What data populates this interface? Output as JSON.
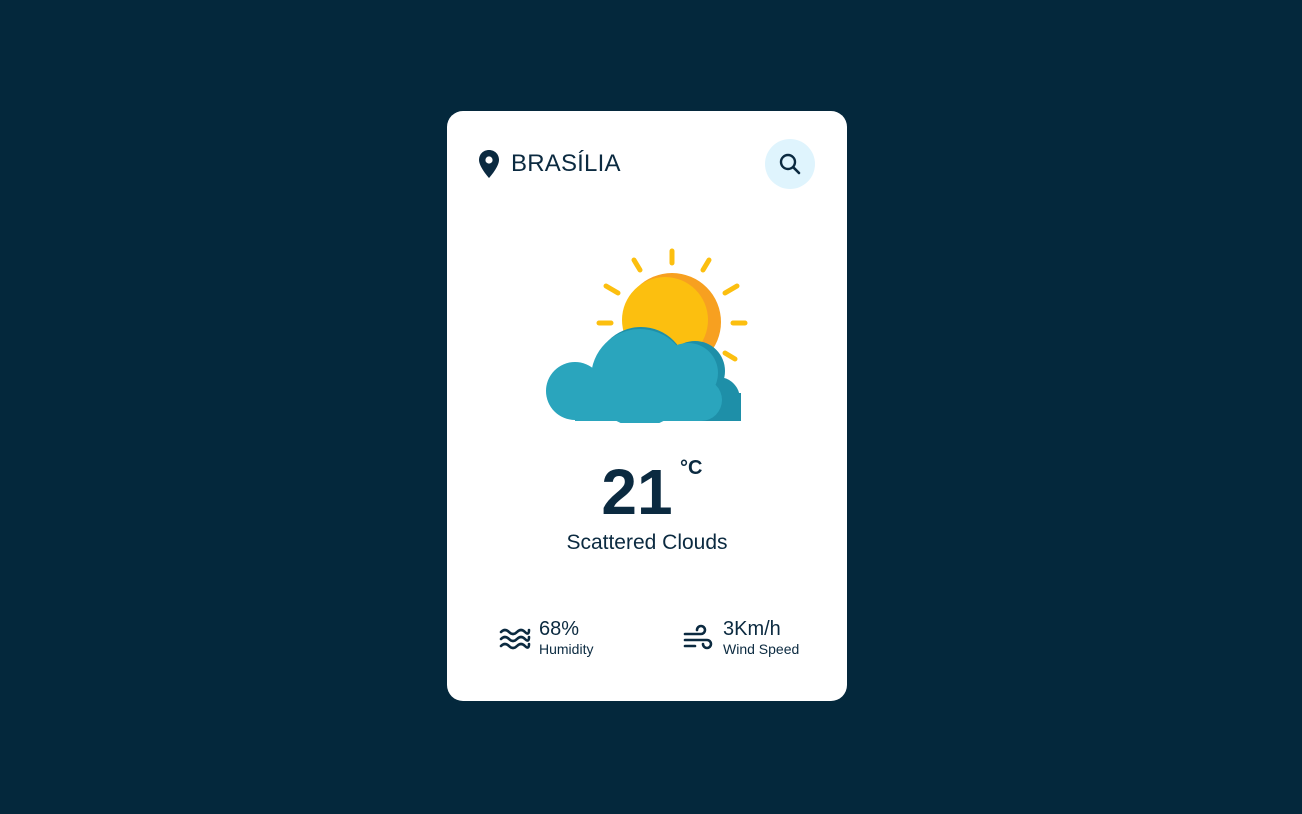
{
  "location": {
    "city": "BRASÍLIA",
    "icon": "location-pin-icon"
  },
  "search": {
    "icon": "search-icon",
    "button_bg": "#dff4fd"
  },
  "weather": {
    "icon": "sun-behind-cloud-icon",
    "temperature": "21",
    "unit": "°C",
    "description": "Scattered Clouds"
  },
  "stats": {
    "humidity": {
      "value": "68%",
      "label": "Humidity",
      "icon": "humidity-waves-icon"
    },
    "wind": {
      "value": "3Km/h",
      "label": "Wind Speed",
      "icon": "wind-icon"
    }
  },
  "colors": {
    "background": "#04283c",
    "card": "#ffffff",
    "text": "#0b2a40",
    "sun": "#fcbf0f",
    "sun_shadow": "#f7a020",
    "cloud": "#2aa5bd",
    "cloud_shadow": "#1e8fa8"
  }
}
